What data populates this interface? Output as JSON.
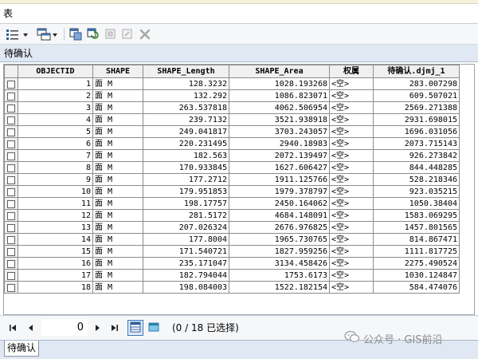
{
  "window": {
    "title": "表"
  },
  "tab": {
    "title": "待确认"
  },
  "table": {
    "columns": [
      "OBJECTID",
      "SHAPE",
      "SHAPE_Length",
      "SHAPE_Area",
      "权属",
      "待确认.djmj_1"
    ],
    "rows": [
      [
        "1",
        "面 M",
        "128.3232",
        "1028.193268",
        "<空>",
        "283.007298"
      ],
      [
        "2",
        "面 M",
        "132.292",
        "1086.823071",
        "<空>",
        "609.507021"
      ],
      [
        "3",
        "面 M",
        "263.537818",
        "4062.506954",
        "<空>",
        "2569.271388"
      ],
      [
        "4",
        "面 M",
        "239.7132",
        "3521.938918",
        "<空>",
        "2931.698015"
      ],
      [
        "5",
        "面 M",
        "249.041817",
        "3703.243057",
        "<空>",
        "1696.031056"
      ],
      [
        "6",
        "面 M",
        "220.231495",
        "2940.18983",
        "<空>",
        "2073.715143"
      ],
      [
        "7",
        "面 M",
        "182.563",
        "2072.139497",
        "<空>",
        "926.273842"
      ],
      [
        "8",
        "面 M",
        "170.933845",
        "1627.606427",
        "<空>",
        "844.448285"
      ],
      [
        "9",
        "面 M",
        "177.2712",
        "1911.125766",
        "<空>",
        "528.218346"
      ],
      [
        "10",
        "面 M",
        "179.951853",
        "1979.378797",
        "<空>",
        "923.035215"
      ],
      [
        "11",
        "面 M",
        "198.17757",
        "2450.164062",
        "<空>",
        "1050.38404"
      ],
      [
        "12",
        "面 M",
        "281.5172",
        "4684.148091",
        "<空>",
        "1583.069295"
      ],
      [
        "13",
        "面 M",
        "207.026324",
        "2676.976825",
        "<空>",
        "1457.801565"
      ],
      [
        "14",
        "面 M",
        "177.8004",
        "1965.730765",
        "<空>",
        "814.867471"
      ],
      [
        "15",
        "面 M",
        "171.540721",
        "1827.959256",
        "<空>",
        "1111.817725"
      ],
      [
        "16",
        "面 M",
        "235.171047",
        "3134.458426",
        "<空>",
        "2275.490524"
      ],
      [
        "17",
        "面 M",
        "182.794044",
        "1753.6173",
        "<空>",
        "1030.124847"
      ],
      [
        "18",
        "面 M",
        "198.084003",
        "1522.182154",
        "<空>",
        "584.474076"
      ]
    ]
  },
  "navigation": {
    "current_record": "0",
    "status": "(0 / 18 已选择)"
  },
  "bottom_tab": {
    "label": "待确认"
  },
  "watermark": {
    "text": "公众号 · GIS前沿"
  },
  "icons": {
    "table_options": "table-options-icon",
    "related_tables": "related-tables-icon",
    "select_by_attributes": "select-by-attributes-icon",
    "switch_selection": "switch-selection-icon",
    "clear_selection": "clear-selection-icon",
    "delete_selected": "delete-selected-icon",
    "first": "first-record-icon",
    "previous": "previous-record-icon",
    "next": "next-record-icon",
    "last": "last-record-icon",
    "show_all": "show-all-records-icon",
    "show_selected": "show-selected-records-icon"
  },
  "colors": {
    "grid_border": "#8c8c8c",
    "header_bg": "#f0f0f0",
    "tabstrip_bg": "#dfe8f3",
    "active_view_border": "#3f77b9"
  }
}
